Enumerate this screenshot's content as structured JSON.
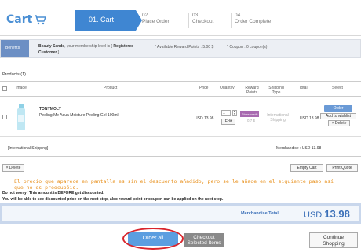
{
  "header": {
    "logo_text": "Cart",
    "steps": [
      {
        "num": "01.",
        "label": "Cart"
      },
      {
        "num": "02.",
        "label": "Place Order"
      },
      {
        "num": "03.",
        "label": "Checkout"
      },
      {
        "num": "04.",
        "label": "Order Complete"
      }
    ]
  },
  "benefits": {
    "label": "Benefits",
    "member_name": "Beauty Sands",
    "member_text": ", your membership level is [",
    "member_level": "Registered Customer",
    "member_end": "]",
    "points_text": "* Available Reward Points : 5.00 $",
    "coupon_text": "* Coupon : 0 coupon(s)"
  },
  "products_title": "Products (1)",
  "table": {
    "headers": [
      "Image",
      "Product",
      "Price",
      "Quantity",
      "Reward Points",
      "Shipping Type",
      "Total",
      "Select"
    ],
    "row": {
      "brand": "TONYMOLY",
      "name": "Peeling Me Aqua Moisture Peeling Gel 100ml",
      "price": "USD 13.98",
      "quantity": "1",
      "edit_label": "Edit",
      "points_badge": "Store credit",
      "points_value": "0.7 $",
      "shipping_type": "International Shipping",
      "total": "USD 13.98",
      "order_label": "Order",
      "wishlist_label": "Add to wishlist",
      "delete_label": "× Delete"
    },
    "shipping_label": "[International Shipping]",
    "merchandise_small": "Merchandise : USD 13.98"
  },
  "actions": {
    "delete_label": "× Delete",
    "empty_cart_label": "Empty Cart",
    "print_quote_label": "Print Quote"
  },
  "notes": {
    "spanish": "El precio que aparece en pantalla es sin el descuento añadido, pero se le añade en el siguiente paso así que no os preocupéis.",
    "line1": "Do not worry! This amount is BEFORE get discounted.",
    "line2": "You will be able to see discounted price on the next step, also reward point or coupon can be applied on the next step."
  },
  "total_box": {
    "label": "Merchandise Total",
    "currency": "USD",
    "amount": "13.98"
  },
  "buttons": {
    "order_all": "Order all",
    "checkout_line1": "Checkout",
    "checkout_line2": "Selected Items",
    "continue_line1": "Continue",
    "continue_line2": "Shopping"
  },
  "colors": {
    "accent": "#3f86d2",
    "highlight_ring": "#d9252c",
    "note": "#e8901c"
  }
}
